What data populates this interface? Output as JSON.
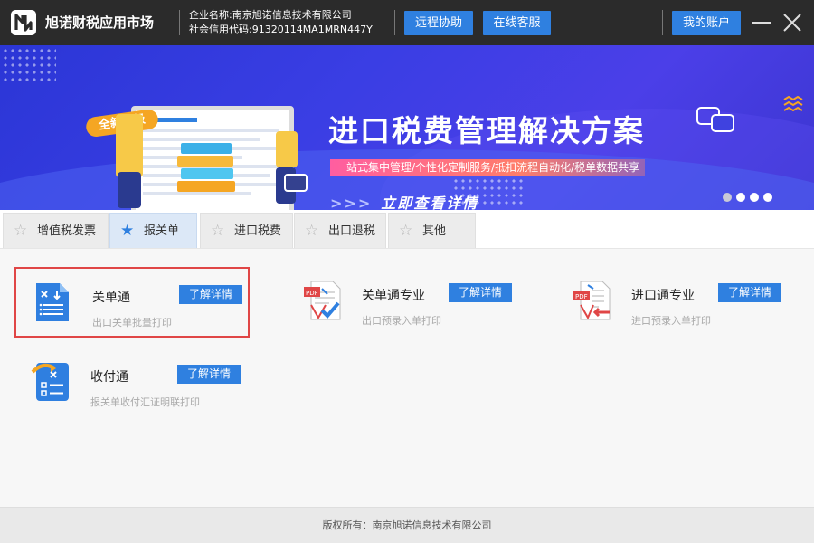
{
  "header": {
    "app_name": "旭诺财税应用市场",
    "company_name": "企业名称:南京旭诺信息技术有限公司",
    "credit_code": "社会信用代码:91320114MA1MRN447Y",
    "remote_assist": "远程协助",
    "online_service": "在线客服",
    "my_account": "我的账户"
  },
  "banner": {
    "upgrade_tag": "全新升级",
    "title": "进口税费管理解决方案",
    "subtitle": "一站式集中管理/个性化定制服务/抵扣流程自动化/税单数据共享",
    "cta_arrows": ">>>",
    "cta": "立即查看详情",
    "slide_count": 4,
    "active_slide": 1
  },
  "tabs": [
    {
      "label": "增值税发票",
      "active": false
    },
    {
      "label": "报关单",
      "active": true
    },
    {
      "label": "进口税费",
      "active": false
    },
    {
      "label": "出口退税",
      "active": false
    },
    {
      "label": "其他",
      "active": false
    }
  ],
  "apps": [
    {
      "name": "关单通",
      "desc": "出口关单批量打印",
      "button": "了解详情",
      "icon": "document-download-icon",
      "selected": true
    },
    {
      "name": "关单通专业",
      "desc": "出口预录入单打印",
      "button": "了解详情",
      "icon": "pdf-check-icon",
      "selected": false
    },
    {
      "name": "进口通专业",
      "desc": "进口预录入单打印",
      "button": "了解详情",
      "icon": "pdf-import-icon",
      "selected": false
    },
    {
      "name": "收付通",
      "desc": "报关单收付汇证明联打印",
      "button": "了解详情",
      "icon": "checklist-icon",
      "selected": false
    }
  ],
  "footer": {
    "copyright": "版权所有：南京旭诺信息技术有限公司"
  },
  "colors": {
    "titlebar": "#2b2b2b",
    "accent": "#2f80e0",
    "selection_border": "#e04646",
    "banner": "#3a3ee4"
  }
}
